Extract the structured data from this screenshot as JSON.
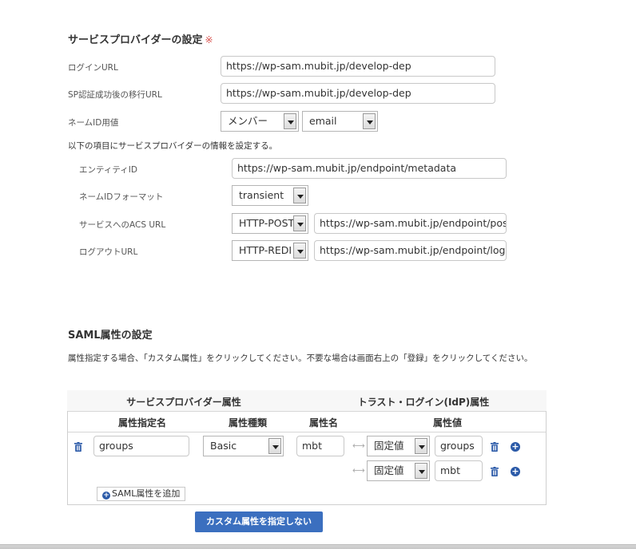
{
  "sp_section": {
    "title": "サービスプロバイダーの設定",
    "required_mark": "※",
    "login_url_label": "ログインURL",
    "login_url_value": "https://wp-sam.mubit.jp/develop-dep",
    "sp_auth_redirect_label": "SP認証成功後の移行URL",
    "sp_auth_redirect_value": "https://wp-sam.mubit.jp/develop-dep",
    "nameid_value_label": "ネームID用値",
    "nameid_source_selected": "メンバー",
    "nameid_field_selected": "email",
    "info_note": "以下の項目にサービスプロバイダーの情報を設定する。",
    "entity_id_label": "エンティティID",
    "entity_id_value": "https://wp-sam.mubit.jp/endpoint/metadata",
    "nameid_format_label": "ネームIDフォーマット",
    "nameid_format_selected": "transient",
    "acs_url_label": "サービスへのACS URL",
    "acs_binding_selected": "HTTP-POST",
    "acs_url_value": "https://wp-sam.mubit.jp/endpoint/postR",
    "logout_url_label": "ログアウトURL",
    "logout_binding_selected": "HTTP-REDI",
    "logout_url_value": "https://wp-sam.mubit.jp/endpoint/logou"
  },
  "saml_section": {
    "title": "SAML属性の設定",
    "note": "属性指定する場合、「カスタム属性」をクリックしてください。不要な場合は画面右上の「登録」をクリックしてください。",
    "table": {
      "group_sp": "サービスプロバイダー属性",
      "group_idp": "トラスト・ログイン(IdP)属性",
      "col_attr_name": "属性指定名",
      "col_attr_type": "属性種類",
      "col_attr_key": "属性名",
      "col_attr_value": "属性値"
    },
    "row": {
      "attr_name": "groups",
      "attr_type": "Basic",
      "attr_key": "mbt",
      "values": [
        {
          "kind": "固定値",
          "value": "groups"
        },
        {
          "kind": "固定値",
          "value": "mbt"
        }
      ]
    },
    "add_button": "SAML属性を追加",
    "no_custom_button": "カスタム属性を指定しない"
  }
}
